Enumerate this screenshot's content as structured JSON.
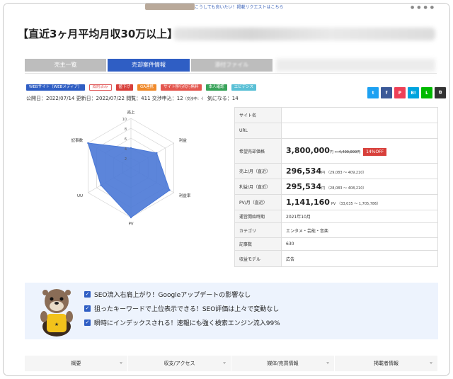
{
  "top_note": "こうしても良いたい！掲載リクエストはこちら",
  "title": "【直近3ヶ月平均月収30万以上】",
  "tabs": [
    {
      "label": "売主一覧"
    },
    {
      "label": "売却案件情報"
    },
    {
      "label": "添付ファイル"
    }
  ],
  "badges": [
    "WEBサイト（WEBメディア）",
    "成約済み",
    "値下げ",
    "GA連携",
    "サイト移行代行無料",
    "本人確認",
    "エビデンス"
  ],
  "share_buttons": [
    {
      "icon": "twitter-icon",
      "glyph": "t",
      "color": "#1da1f2"
    },
    {
      "icon": "facebook-icon",
      "glyph": "f",
      "color": "#3b5998"
    },
    {
      "icon": "pocket-icon",
      "glyph": "P",
      "color": "#ee4056"
    },
    {
      "icon": "hatena-icon",
      "glyph": "B!",
      "color": "#00a4de"
    },
    {
      "icon": "line-icon",
      "glyph": "L",
      "color": "#00b900"
    },
    {
      "icon": "copy-icon",
      "glyph": "⧉",
      "color": "#333333"
    }
  ],
  "meta": {
    "published": "公開日：2022/07/14",
    "updated": "更新日：2022/07/22",
    "views": "閲覧：411",
    "negotiations": "交渉申込：12",
    "negotiations_note": "（交渉中：-）",
    "favorites": "気になる：14"
  },
  "radar": {
    "axes": [
      "売上",
      "利益",
      "利益率",
      "PV",
      "UU",
      "記事数"
    ],
    "scale_labels": [
      "10",
      "8",
      "6",
      "4",
      "2"
    ],
    "values": [
      4,
      6,
      9,
      10,
      7,
      10
    ],
    "max": 10,
    "fill_color": "#4a78d6"
  },
  "table": {
    "site_name_label": "サイト名",
    "url_label": "URL",
    "price_label": "希望売却価格",
    "price_value": "3,800,000",
    "price_unit": "円",
    "price_original": "← 4,400,000円",
    "price_discount": "14%OFF",
    "sales_label": "売上/月（直近）",
    "sales_value": "296,534",
    "sales_unit": "円",
    "sales_range": "（29,083 ～ 409,210）",
    "profit_label": "利益/月（直近）",
    "profit_value": "295,534",
    "profit_unit": "円",
    "profit_range": "（28,083 ～ 408,210）",
    "pv_label": "PV/月（直近）",
    "pv_value": "1,141,160",
    "pv_unit": "PV",
    "pv_range": "（33,035 ～ 1,705,786）",
    "start_label": "運営開始時期",
    "start_value": "2021年10月",
    "category_label": "カテゴリ",
    "category_value": "エンタメ・芸能・音楽",
    "articles_label": "記事数",
    "articles_value": "630",
    "revenue_label": "収益モデル",
    "revenue_value": "広告"
  },
  "promo": {
    "items": [
      "SEO流入右肩上がり！Googleアップデートの影響なし",
      "狙ったキーワードで上位表示できる！SEO評価は上々で変動なし",
      "瞬時にインデックスされる！速報にも強く検索エンジン流入99%"
    ]
  },
  "accordion": [
    "概要",
    "収支/アクセス",
    "媒体/売買情報",
    "掲載者情報"
  ]
}
